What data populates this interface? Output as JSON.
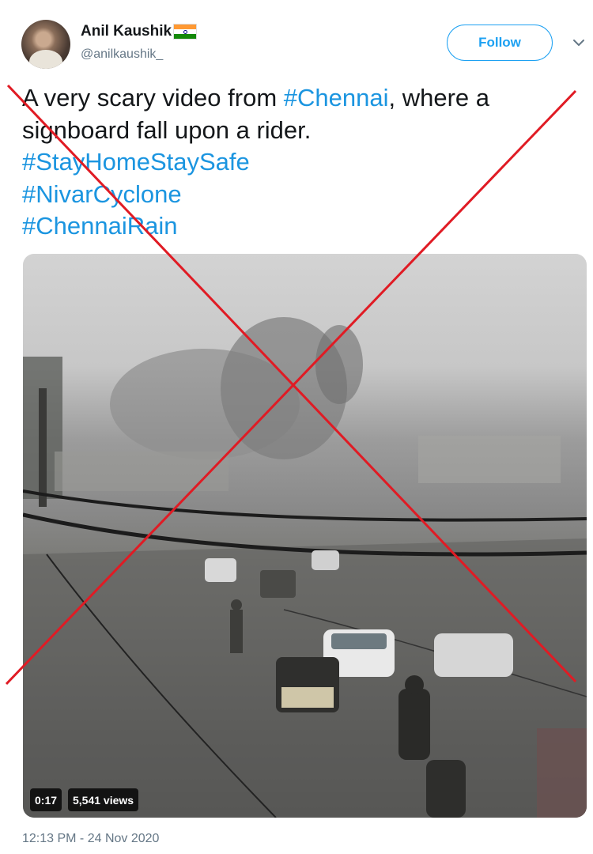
{
  "author": {
    "name": "Anil Kaushik",
    "flag_icon": "india-flag-icon",
    "handle": "@anilkaushik_"
  },
  "follow_button": {
    "label": "Follow"
  },
  "menu_icon": "chevron-down-icon",
  "tweet": {
    "lines": [
      [
        {
          "text": "A very scary video from ",
          "type": "text"
        },
        {
          "text": "#Chennai",
          "type": "hashtag"
        },
        {
          "text": ", where a",
          "type": "text"
        }
      ],
      [
        {
          "text": "signboard fall upon a rider.",
          "type": "text"
        }
      ],
      [
        {
          "text": "#StayHomeStaySafe",
          "type": "hashtag"
        }
      ],
      [
        {
          "text": "#NivarCyclone",
          "type": "hashtag"
        }
      ],
      [
        {
          "text": "#ChennaiRain",
          "type": "hashtag"
        }
      ]
    ]
  },
  "video": {
    "duration": "0:17",
    "views": "5,541 views"
  },
  "timestamp": "12:13 PM - 24 Nov 2020",
  "colors": {
    "hashtag": "#1b95e0",
    "follow": "#1da1f2",
    "muted": "#657786",
    "cross": "#e01b24"
  }
}
